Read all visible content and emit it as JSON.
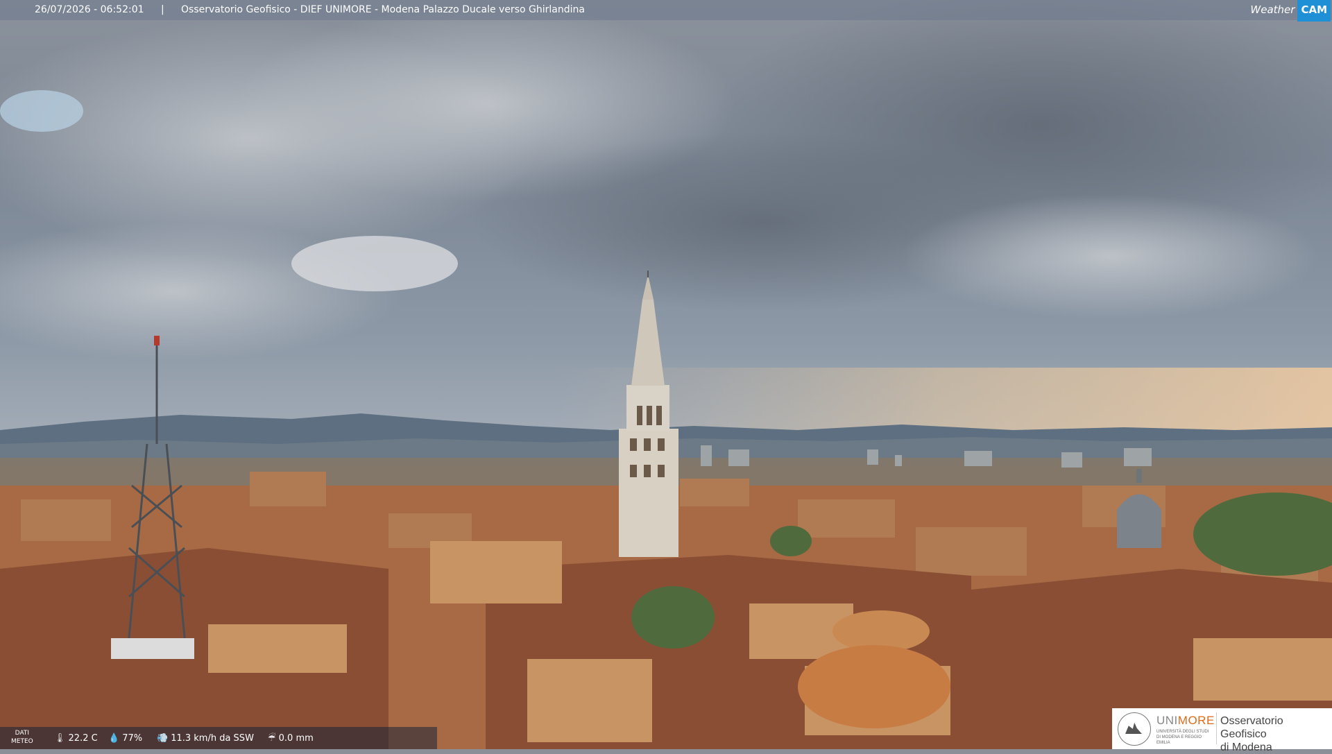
{
  "header": {
    "datetime": "26/07/2026 - 06:52:01",
    "separator": "|",
    "caption": "Osservatorio Geofisico - DIEF UNIMORE - Modena Palazzo Ducale verso Ghirlandina",
    "brand_weather": "Weather",
    "brand_cam": "CAM",
    "brand_accent": "#1f8fd6"
  },
  "weather": {
    "label_line1": "DATI",
    "label_line2": "METEO",
    "temperature": "22.2 C",
    "humidity": "77%",
    "wind": "11.3 km/h da SSW",
    "rain": "0.0 mm",
    "icons": [
      "thermometer-icon",
      "humidity-drop-icon",
      "wind-icon",
      "rain-icon"
    ]
  },
  "logo": {
    "uni_prefix": "UNI",
    "uni_suffix": "MORE",
    "uni_subtitle": "UNIVERSITÀ DEGLI STUDI DI MODENA E REGGIO EMILIA",
    "observatory_line1": "Osservatorio Geofisico",
    "observatory_line2": "di Modena",
    "accent": "#e06a1b"
  }
}
